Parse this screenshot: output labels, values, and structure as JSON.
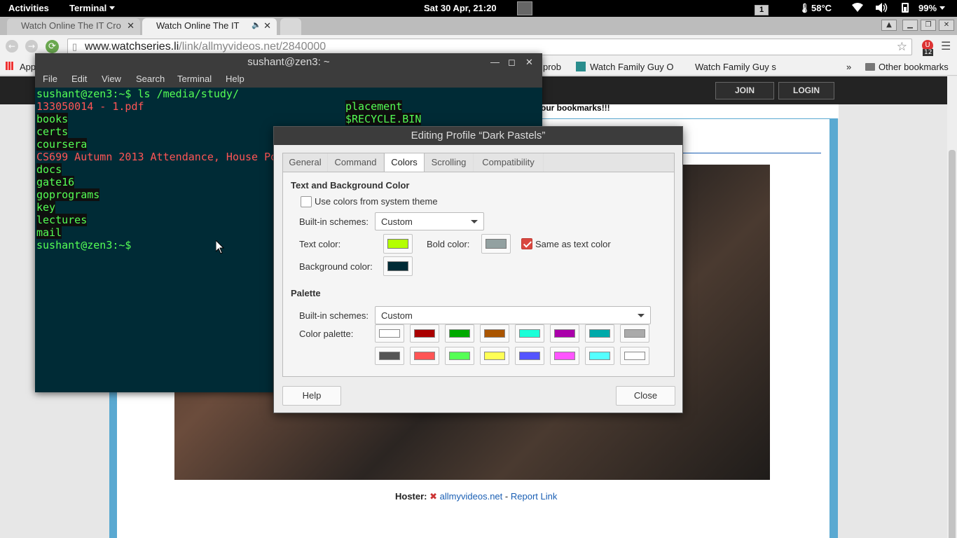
{
  "topbar": {
    "activities": "Activities",
    "app_menu": "Terminal",
    "clock": "Sat 30 Apr, 21:20",
    "workspace": "1",
    "temperature": "58°C",
    "battery": "99%"
  },
  "browser": {
    "tabs": [
      {
        "label": "Watch Online The IT Cro"
      },
      {
        "label": "Watch Online The IT"
      }
    ],
    "url_domain": "www.watchseries.li",
    "url_path": "/link/allmyvideos.net/2840000",
    "extension_badge": "12",
    "bookmarks": {
      "apps": "Apps",
      "truncated": "prob",
      "item1": "Watch Family Guy O",
      "item2": "Watch Family Guy s",
      "overflow": "»",
      "other": "Other bookmarks"
    }
  },
  "site": {
    "join": "JOIN",
    "login": "LOGIN",
    "notice": "our bookmarks!!!",
    "hoster_label": "Hoster:",
    "hoster_link": "allmyvideos.net",
    "separator": "-",
    "report_link": "Report Link"
  },
  "terminal": {
    "title": "sushant@zen3: ~",
    "menu": [
      "File",
      "Edit",
      "View",
      "Search",
      "Terminal",
      "Help"
    ],
    "prompt": "sushant@zen3:~$",
    "command": " ls /media/study/",
    "col1": [
      "133050014 - 1.pdf",
      "books",
      "certs",
      "coursera",
      "CS699 Autumn 2013 Attendance, House Po",
      "docs",
      "gate16",
      "goprograms",
      "key",
      "lectures",
      "mail"
    ],
    "col2": [
      "placement",
      "$RECYCLE.BIN"
    ]
  },
  "dialog": {
    "title": "Editing Profile “Dark Pastels”",
    "tabs": [
      "General",
      "Command",
      "Colors",
      "Scrolling",
      "Compatibility"
    ],
    "active_tab": "Colors",
    "section_text_bg": "Text and Background Color",
    "use_system_theme": "Use colors from system theme",
    "use_system_theme_checked": false,
    "builtin_schemes_label": "Built-in schemes:",
    "builtin_scheme_value": "Custom",
    "text_color_label": "Text color:",
    "text_color": "#b4ff00",
    "bold_color_label": "Bold color:",
    "bold_color": "#93a1a1",
    "same_as_text": "Same as text color",
    "same_as_text_checked": true,
    "background_color_label": "Background color:",
    "background_color": "#002b36",
    "section_palette": "Palette",
    "palette_schemes_label": "Built-in schemes:",
    "palette_scheme_value": "Custom",
    "color_palette_label": "Color palette:",
    "palette": [
      "#ffffff",
      "#aa0000",
      "#00aa00",
      "#aa5500",
      "#1affd8",
      "#aa00aa",
      "#00aaaa",
      "#aaaaaa",
      "#555555",
      "#ff5555",
      "#55ff55",
      "#ffff55",
      "#5555ff",
      "#ff55ff",
      "#55ffff",
      "#ffffff"
    ],
    "help": "Help",
    "close": "Close"
  }
}
